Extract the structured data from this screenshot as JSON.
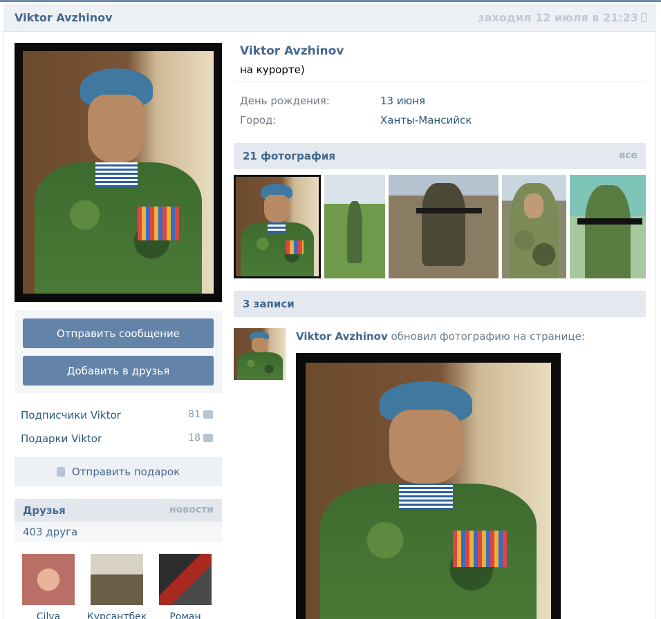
{
  "header": {
    "name": "Viktor Avzhinov",
    "last_seen": "заходил 12 июля в 21:23"
  },
  "profile": {
    "name": "Viktor Avzhinov",
    "status": "на курорте)",
    "info": [
      {
        "label": "День рождения:",
        "value": "13 июня"
      },
      {
        "label": "Город:",
        "value": "Ханты-Мансийск"
      }
    ]
  },
  "actions": {
    "send_message": "Отправить сообщение",
    "add_friend": "Добавить в друзья",
    "send_gift": "Отправить подарок"
  },
  "counters": [
    {
      "label": "Подписчики Viktor",
      "count": "81",
      "icon": "followers-icon"
    },
    {
      "label": "Подарки Viktor",
      "count": "18",
      "icon": "gift-icon"
    }
  ],
  "friends": {
    "title": "Друзья",
    "news_link": "новости",
    "count": "403 друга",
    "items": [
      {
        "name": "Cilya"
      },
      {
        "name": "Курсантбек"
      },
      {
        "name": "Роман"
      }
    ]
  },
  "photos": {
    "title": "21 фотография",
    "all_link": "все"
  },
  "wall": {
    "title": "3 записи",
    "post": {
      "author": "Viktor Avzhinov",
      "action": " обновил фотографию на странице:"
    }
  },
  "colors": {
    "link": "#45688e",
    "button": "#6383a8",
    "header_bg": "#edf1f5",
    "section_bg": "#e3e9ef"
  }
}
